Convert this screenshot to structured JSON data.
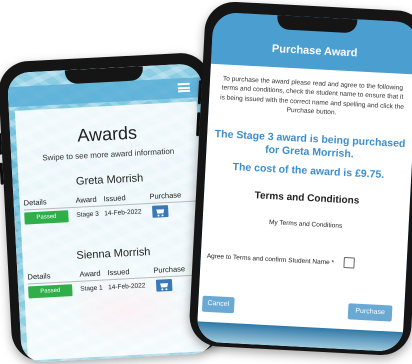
{
  "awards_screen": {
    "title": "Awards",
    "subtitle": "Swipe to see more award information",
    "columns": [
      "Details",
      "Award",
      "Issued",
      "Purchase"
    ],
    "students": [
      {
        "name": "Greta Morrish",
        "status": "Passed",
        "award": "Stage 3",
        "issued": "14-Feb-2022"
      },
      {
        "name": "Sienna Morrish",
        "status": "Passed",
        "award": "Stage 1",
        "issued": "14-Feb-2022"
      }
    ]
  },
  "purchase_modal": {
    "title": "Purchase Award",
    "intro": "To purchase the award please read and agree to the following terms and conditions, check the student name to ensure that it is being issued with the correct name and spelling and click the Purchase button.",
    "award_statement": "The Stage 3 award is being purchased for Greta Morrish.",
    "cost_statement": "The cost of the award is £9.75.",
    "terms_heading": "Terms and Conditions",
    "terms_text": "My Terms and Conditions",
    "agree_label": "Agree to Terms and confirm Student Name *",
    "cancel_label": "Cancel",
    "purchase_label": "Purchase"
  },
  "icons": {
    "menu": "hamburger-icon",
    "cart": "cart-icon"
  },
  "colors": {
    "passed": "#2fae4a",
    "accent": "#4a9ed0",
    "highlight_text": "#3b8ed0",
    "cart_button": "#3a79b8"
  }
}
